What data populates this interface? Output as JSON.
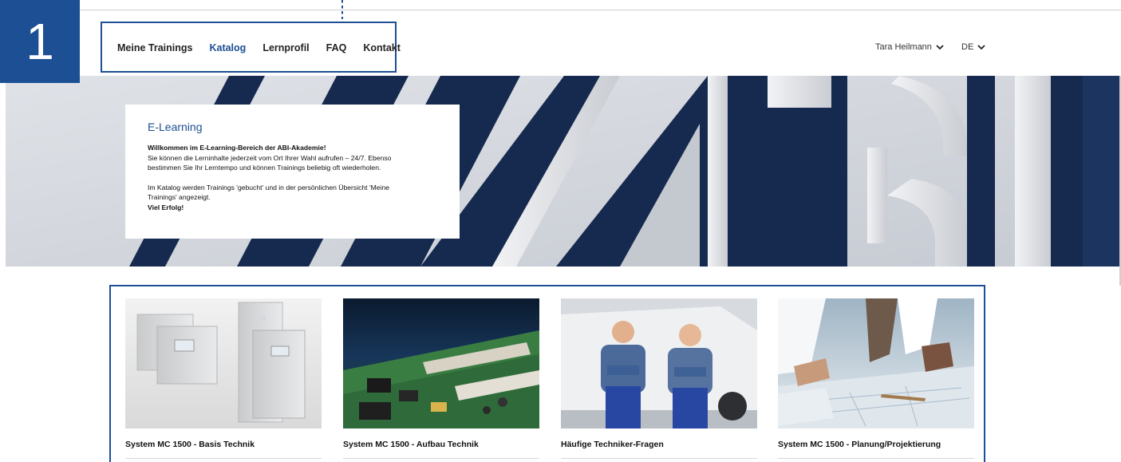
{
  "step": {
    "number": "1"
  },
  "nav": {
    "items": [
      {
        "label": "Meine Trainings",
        "active": false
      },
      {
        "label": "Katalog",
        "active": true
      },
      {
        "label": "Lernprofil",
        "active": false
      },
      {
        "label": "FAQ",
        "active": false
      },
      {
        "label": "Kontakt",
        "active": false
      }
    ]
  },
  "user": {
    "name": "Tara Heilmann",
    "icon": "chevron-down-icon"
  },
  "language": {
    "code": "DE",
    "icon": "chevron-down-icon"
  },
  "intro": {
    "title": "E-Learning",
    "welcome": "Willkommen im E-Learning-Bereich der ABI-Akademie!",
    "line1": "Sie können die Lerninhalte jederzeit vom Ort Ihrer Wahl aufrufen – 24/7. Ebenso",
    "line2": "bestimmen Sie Ihr Lerntempo und können Trainings beliebig oft wiederholen.",
    "line3": "Im Katalog werden Trainings 'gebucht' und in der persönlichen Übersicht 'Meine",
    "line4": "Trainings' angezeigt.",
    "closing": "Viel Erfolg!"
  },
  "courses": [
    {
      "title": "System MC 1500 - Basis Technik"
    },
    {
      "title": "System MC 1500 - Aufbau Technik"
    },
    {
      "title": "Häufige Techniker-Fragen"
    },
    {
      "title": "System MC 1500 - Planung/Projektierung"
    }
  ],
  "colors": {
    "accent": "#1c4f94",
    "navy": "#152a4e"
  }
}
